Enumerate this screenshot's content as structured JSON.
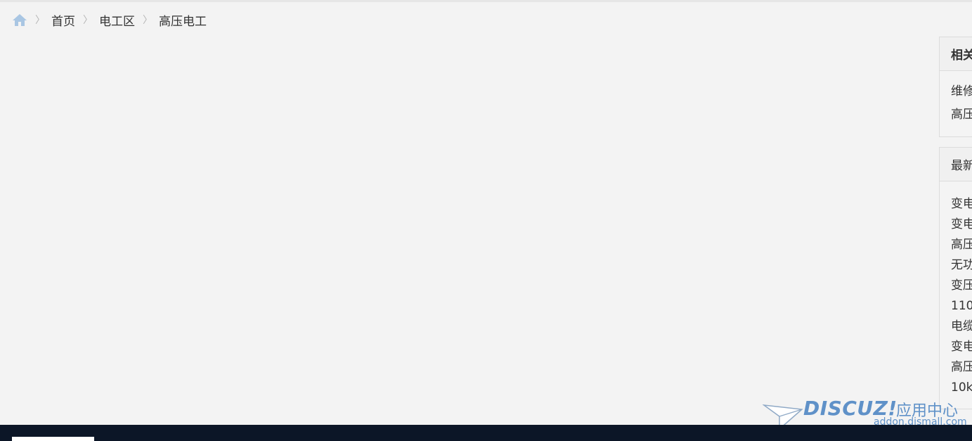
{
  "breadcrumb": {
    "items": [
      {
        "label": "首页"
      },
      {
        "label": "电工区"
      },
      {
        "label": "高压电工"
      }
    ],
    "separator": "〉"
  },
  "sidebar": {
    "related": {
      "title": "相关",
      "items": [
        "维修",
        "高压"
      ]
    },
    "latest": {
      "title": "最新",
      "items": [
        "变电",
        "变电",
        "高压",
        "无功",
        "变压",
        "110",
        "电缆",
        "变电",
        "高压",
        "10k"
      ]
    }
  },
  "watermark": {
    "brand": "DISCUZ!",
    "suffix": "应用中心",
    "url": "addon.dismall.com"
  },
  "colors": {
    "background": "#f3f3f3",
    "footer": "#0c1627",
    "home_icon": "#a9c6e3",
    "watermark": "#5f91c8"
  }
}
